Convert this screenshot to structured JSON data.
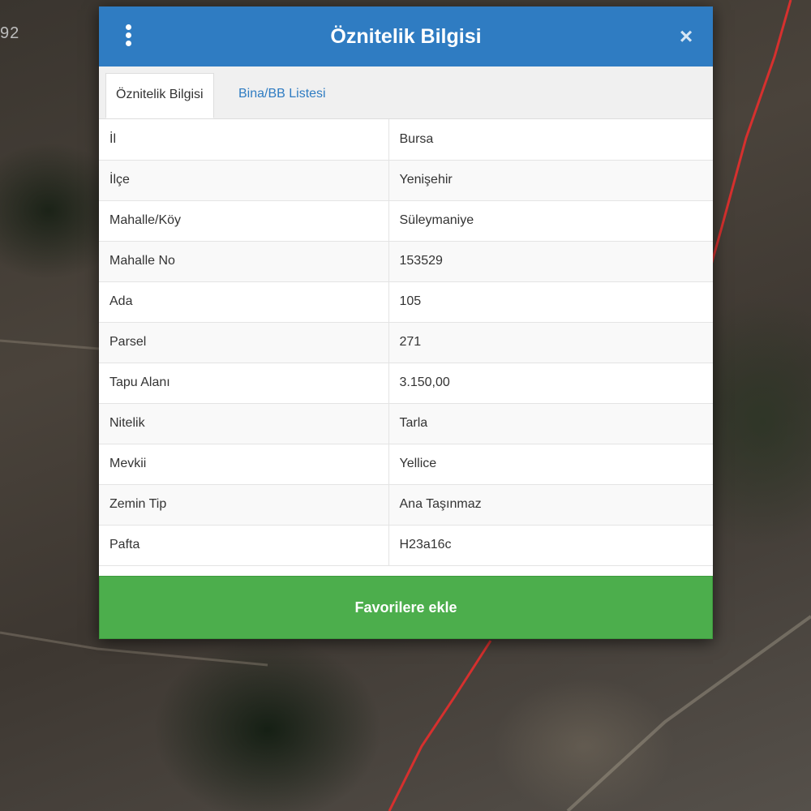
{
  "map": {
    "coordinate_fragment": "92",
    "parcel_boundary_color": "#d6302e"
  },
  "dialog": {
    "title": "Öznitelik Bilgisi",
    "menu_icon": "kebab-menu-icon",
    "close_icon": "close-icon",
    "close_glyph": "×",
    "header_color": "#2f7cc2",
    "tabs": [
      {
        "label": "Öznitelik Bilgisi",
        "active": true
      },
      {
        "label": "Bina/BB Listesi",
        "active": false
      }
    ],
    "attributes": [
      {
        "key": "İl",
        "value": "Bursa"
      },
      {
        "key": "İlçe",
        "value": "Yenişehir"
      },
      {
        "key": "Mahalle/Köy",
        "value": "Süleymaniye"
      },
      {
        "key": "Mahalle No",
        "value": "153529"
      },
      {
        "key": "Ada",
        "value": "105"
      },
      {
        "key": "Parsel",
        "value": "271"
      },
      {
        "key": "Tapu Alanı",
        "value": "3.150,00"
      },
      {
        "key": "Nitelik",
        "value": "Tarla"
      },
      {
        "key": "Mevkii",
        "value": "Yellice"
      },
      {
        "key": "Zemin Tip",
        "value": "Ana Taşınmaz"
      },
      {
        "key": "Pafta",
        "value": "H23a16c"
      }
    ],
    "favorite_button_label": "Favorilere ekle",
    "favorite_button_color": "#4cae4c"
  }
}
